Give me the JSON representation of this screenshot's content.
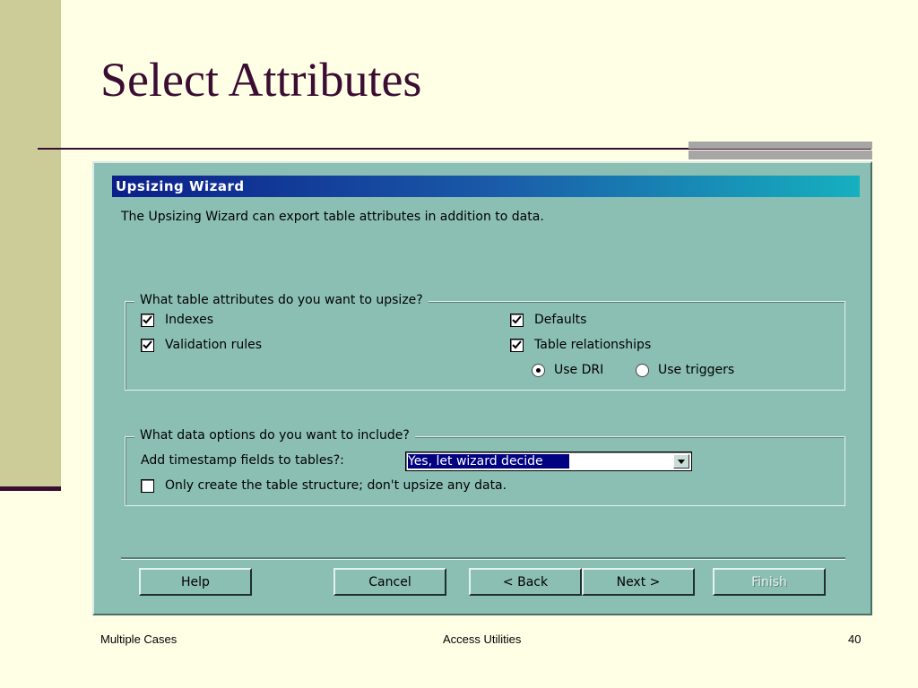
{
  "slide": {
    "title": "Select Attributes",
    "footer_left": "Multiple Cases",
    "footer_center": "Access Utilities",
    "footer_right": "40"
  },
  "dialog": {
    "title": "Upsizing Wizard",
    "intro": "The Upsizing Wizard can export table attributes in addition to data.",
    "attributes_group": {
      "legend": "What table attributes do you want to upsize?",
      "indexes": {
        "label": "Indexes",
        "checked": true
      },
      "validation_rules": {
        "label": "Validation rules",
        "checked": true
      },
      "defaults": {
        "label": "Defaults",
        "checked": true
      },
      "table_relationships": {
        "label": "Table relationships",
        "checked": true
      },
      "use_dri": {
        "label": "Use DRI",
        "selected": true
      },
      "use_triggers": {
        "label": "Use triggers",
        "selected": false
      }
    },
    "data_group": {
      "legend": "What data options do you want to include?",
      "timestamp_label": "Add timestamp fields to tables?:",
      "timestamp_value": "Yes, let wizard decide",
      "structure_only": {
        "label": "Only create the table structure; don't upsize any data.",
        "checked": false
      }
    },
    "buttons": {
      "help": "Help",
      "cancel": "Cancel",
      "back": "< Back",
      "next": "Next >",
      "finish": "Finish"
    }
  }
}
